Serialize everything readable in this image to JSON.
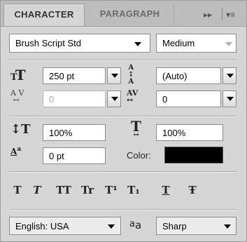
{
  "tabs": {
    "character": "CHARACTER",
    "paragraph": "PARAGRAPH",
    "expand": "▸▸",
    "menu": "▾≡"
  },
  "font": {
    "family": "Brush Script Std",
    "style": "Medium"
  },
  "size": {
    "font_size": "250 pt",
    "leading": "(Auto)"
  },
  "kerning": {
    "value": "0",
    "tracking": "0"
  },
  "scale": {
    "vertical": "100%",
    "horizontal": "100%"
  },
  "baseline": {
    "value": "0 pt",
    "color_label": "Color:",
    "color": "#000000"
  },
  "styles": [
    "T",
    "T",
    "TT",
    "Tr",
    "T¹",
    "T₁",
    "T",
    "Ŧ"
  ],
  "language": {
    "value": "English: USA",
    "aa_icon": "a a",
    "antialias": "Sharp"
  },
  "icons": {
    "font_size": "font-size-icon",
    "leading": "leading-icon",
    "kerning": "kerning-icon",
    "tracking": "tracking-icon",
    "vertical_scale": "vertical-scale-icon",
    "horizontal_scale": "horizontal-scale-icon",
    "baseline_shift": "baseline-shift-icon",
    "anti_alias": "anti-alias-icon"
  }
}
